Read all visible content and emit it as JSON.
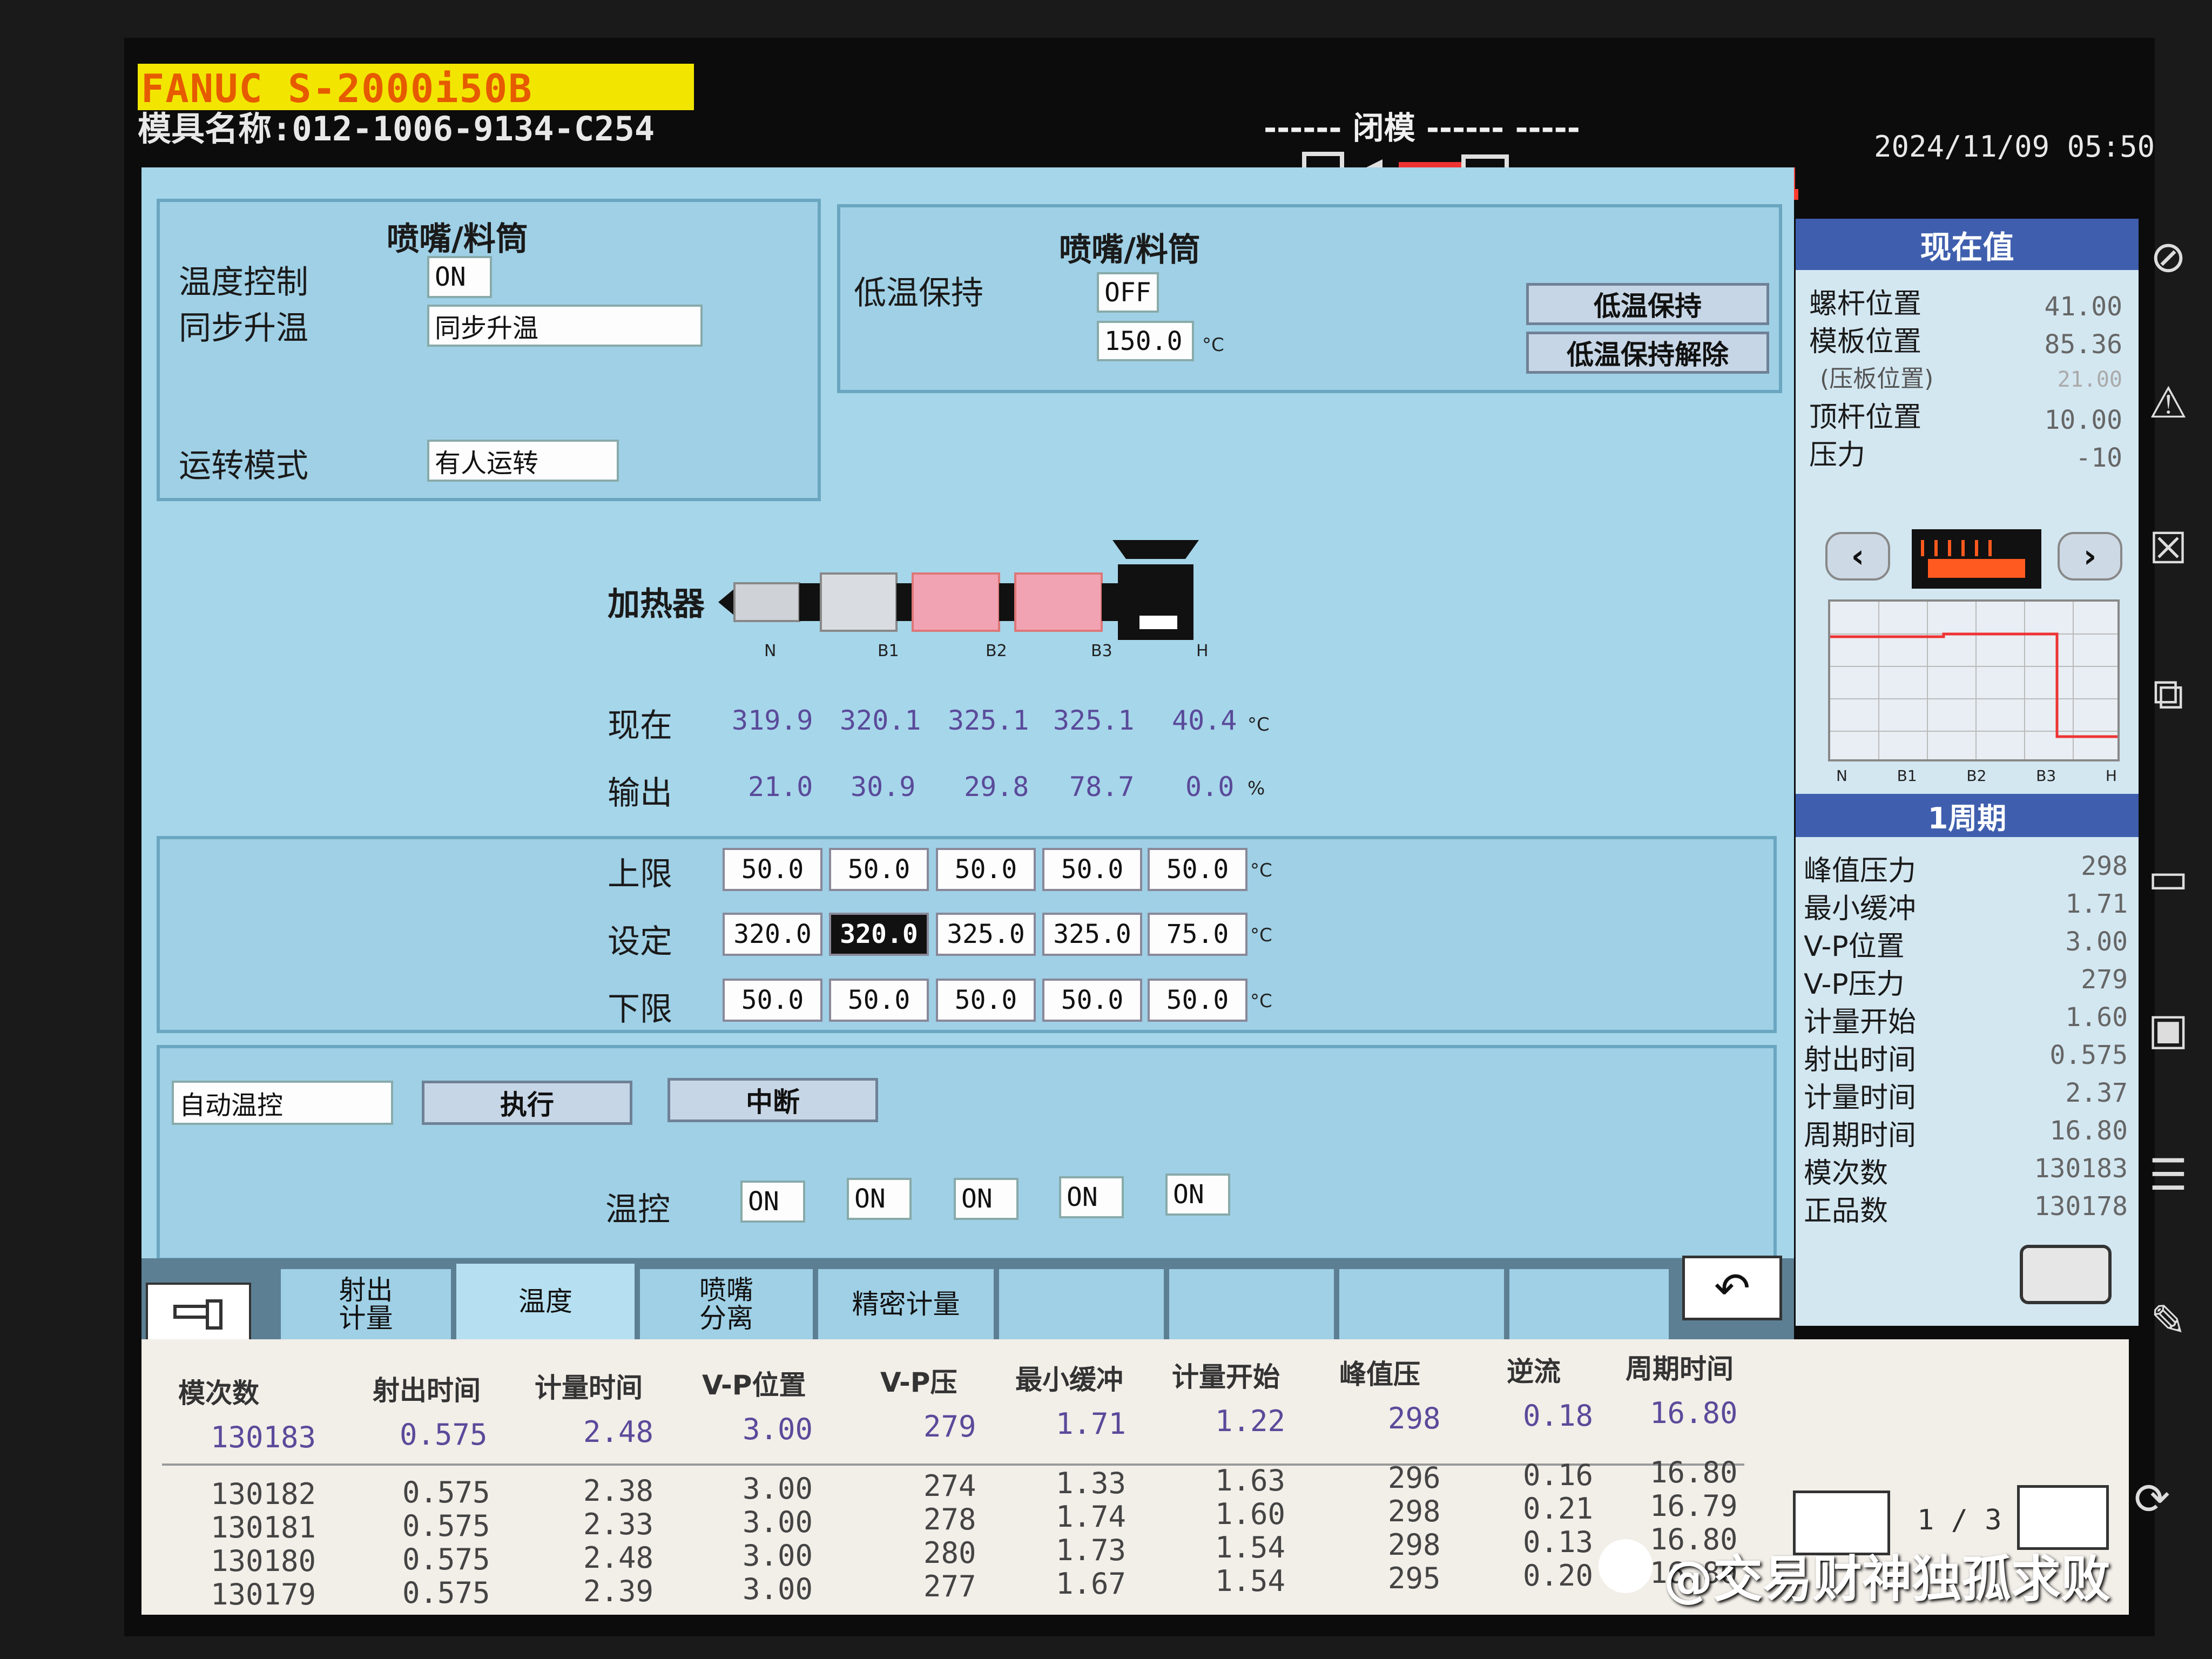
{
  "header": {
    "machine": "FANUC S-2000i50B",
    "mold_name": "模具名称:012-1006-9134-C254",
    "status": "------ 闭模 ------ -----",
    "datetime": "2024/11/09 05:50"
  },
  "top_left_panel": {
    "title": "喷嘴/料筒",
    "temp_control_label": "温度控制",
    "temp_control_value": "ON",
    "sync_heat_label": "同步升温",
    "sync_heat_value": "同步升温",
    "run_mode_label": "运转模式",
    "run_mode_value": "有人运转"
  },
  "top_right_panel": {
    "title": "喷嘴/料筒",
    "low_temp_label": "低温保持",
    "low_temp_state": "OFF",
    "low_temp_value": "150.0",
    "unit": "°C",
    "btn_hold": "低温保持",
    "btn_release": "低温保持解除"
  },
  "heater": {
    "label": "加热器",
    "zones": [
      "N",
      "B1",
      "B2",
      "B3",
      "H"
    ],
    "current_label": "现在",
    "current": [
      "319.9",
      "320.1",
      "325.1",
      "325.1",
      "40.4"
    ],
    "current_unit": "°C",
    "output_label": "输出",
    "output": [
      "21.0",
      "30.9",
      "29.8",
      "78.7",
      "0.0"
    ],
    "output_unit": "%",
    "upper_label": "上限",
    "upper": [
      "50.0",
      "50.0",
      "50.0",
      "50.0",
      "50.0"
    ],
    "set_label": "设定",
    "set": [
      "320.0",
      "320.0",
      "325.0",
      "325.0",
      "75.0"
    ],
    "lower_label": "下限",
    "lower": [
      "50.0",
      "50.0",
      "50.0",
      "50.0",
      "50.0"
    ],
    "unit": "°C"
  },
  "control_panel": {
    "mode": "自动温控",
    "exec_btn": "执行",
    "stop_btn": "中断",
    "temp_ctrl_label": "温控",
    "states": [
      "ON",
      "ON",
      "ON",
      "ON",
      "ON"
    ]
  },
  "current_values": {
    "title": "现在值",
    "rows": [
      {
        "label": "螺杆位置",
        "value": "41.00"
      },
      {
        "label": "模板位置",
        "value": "85.36"
      },
      {
        "label": "(压板位置)",
        "value": "21.00"
      },
      {
        "label": "顶杆位置",
        "value": "10.00"
      },
      {
        "label": "压力",
        "value": "-10"
      }
    ],
    "graph_zones": [
      "N",
      "B1",
      "B2",
      "B3",
      "H"
    ]
  },
  "cycle": {
    "title": "1周期",
    "rows": [
      {
        "label": "峰值压力",
        "value": "298"
      },
      {
        "label": "最小缓冲",
        "value": "1.71"
      },
      {
        "label": "V-P位置",
        "value": "3.00"
      },
      {
        "label": "V-P压力",
        "value": "279"
      },
      {
        "label": "计量开始",
        "value": "1.60"
      },
      {
        "label": "射出时间",
        "value": "0.575"
      },
      {
        "label": "计量时间",
        "value": "2.37"
      },
      {
        "label": "周期时间",
        "value": "16.80"
      },
      {
        "label": "模次数",
        "value": "130183"
      },
      {
        "label": "正品数",
        "value": "130178"
      }
    ]
  },
  "tabs": [
    "射出\n计量",
    "温度",
    "喷嘴\n分离",
    "精密计量"
  ],
  "table": {
    "headers": [
      "模次数",
      "射出时间",
      "计量时间",
      "V-P位置",
      "V-P压",
      "最小缓冲",
      "计量开始",
      "峰值压",
      "逆流",
      "周期时间"
    ],
    "current_row": [
      "130183",
      "0.575",
      "2.48",
      "3.00",
      "279",
      "1.71",
      "1.22",
      "298",
      "0.18",
      "16.80"
    ],
    "rows": [
      [
        "130182",
        "0.575",
        "2.38",
        "3.00",
        "274",
        "1.33",
        "1.63",
        "296",
        "0.16",
        "16.80"
      ],
      [
        "130181",
        "0.575",
        "2.33",
        "3.00",
        "278",
        "1.74",
        "1.60",
        "298",
        "0.21",
        "16.79"
      ],
      [
        "130180",
        "0.575",
        "2.48",
        "3.00",
        "280",
        "1.73",
        "1.54",
        "298",
        "0.13",
        "16.80"
      ],
      [
        "130179",
        "0.575",
        "2.39",
        "3.00",
        "277",
        "1.67",
        "1.54",
        "295",
        "0.20",
        "16.80"
      ]
    ],
    "page": "1 / 3"
  },
  "watermark": "@交易财神独孤求败",
  "colors": {
    "panel": "#9fd0e6",
    "heater_hot": "#f2a3b3",
    "header_yellow": "#f2e600"
  }
}
